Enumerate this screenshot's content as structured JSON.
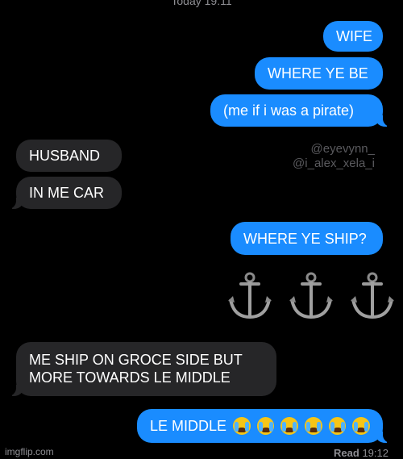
{
  "header": {
    "timestamp": "Today 19:11"
  },
  "watermark": {
    "line1": "@eyevynn_",
    "line2": "@i_alex_xela_i"
  },
  "messages": [
    {
      "text": "WIFE"
    },
    {
      "text": "WHERE YE BE"
    },
    {
      "text": "(me if i was a pirate)"
    },
    {
      "text": "HUSBAND"
    },
    {
      "text": "IN ME CAR"
    },
    {
      "text": "WHERE YE SHIP?"
    },
    {
      "text": "ME SHIP ON GROCE SIDE BUT"
    },
    {
      "text": "MORE TOWARDS LE MIDDLE"
    },
    {
      "text": "LE MIDDLE"
    }
  ],
  "anchors": {
    "icon": "anchor-icon",
    "count": 3
  },
  "emoji": {
    "icon": "loudly-crying-face-icon",
    "count": 6
  },
  "footer": {
    "site": "imgflip.com",
    "read_label": "Read",
    "read_time": "19:12"
  }
}
